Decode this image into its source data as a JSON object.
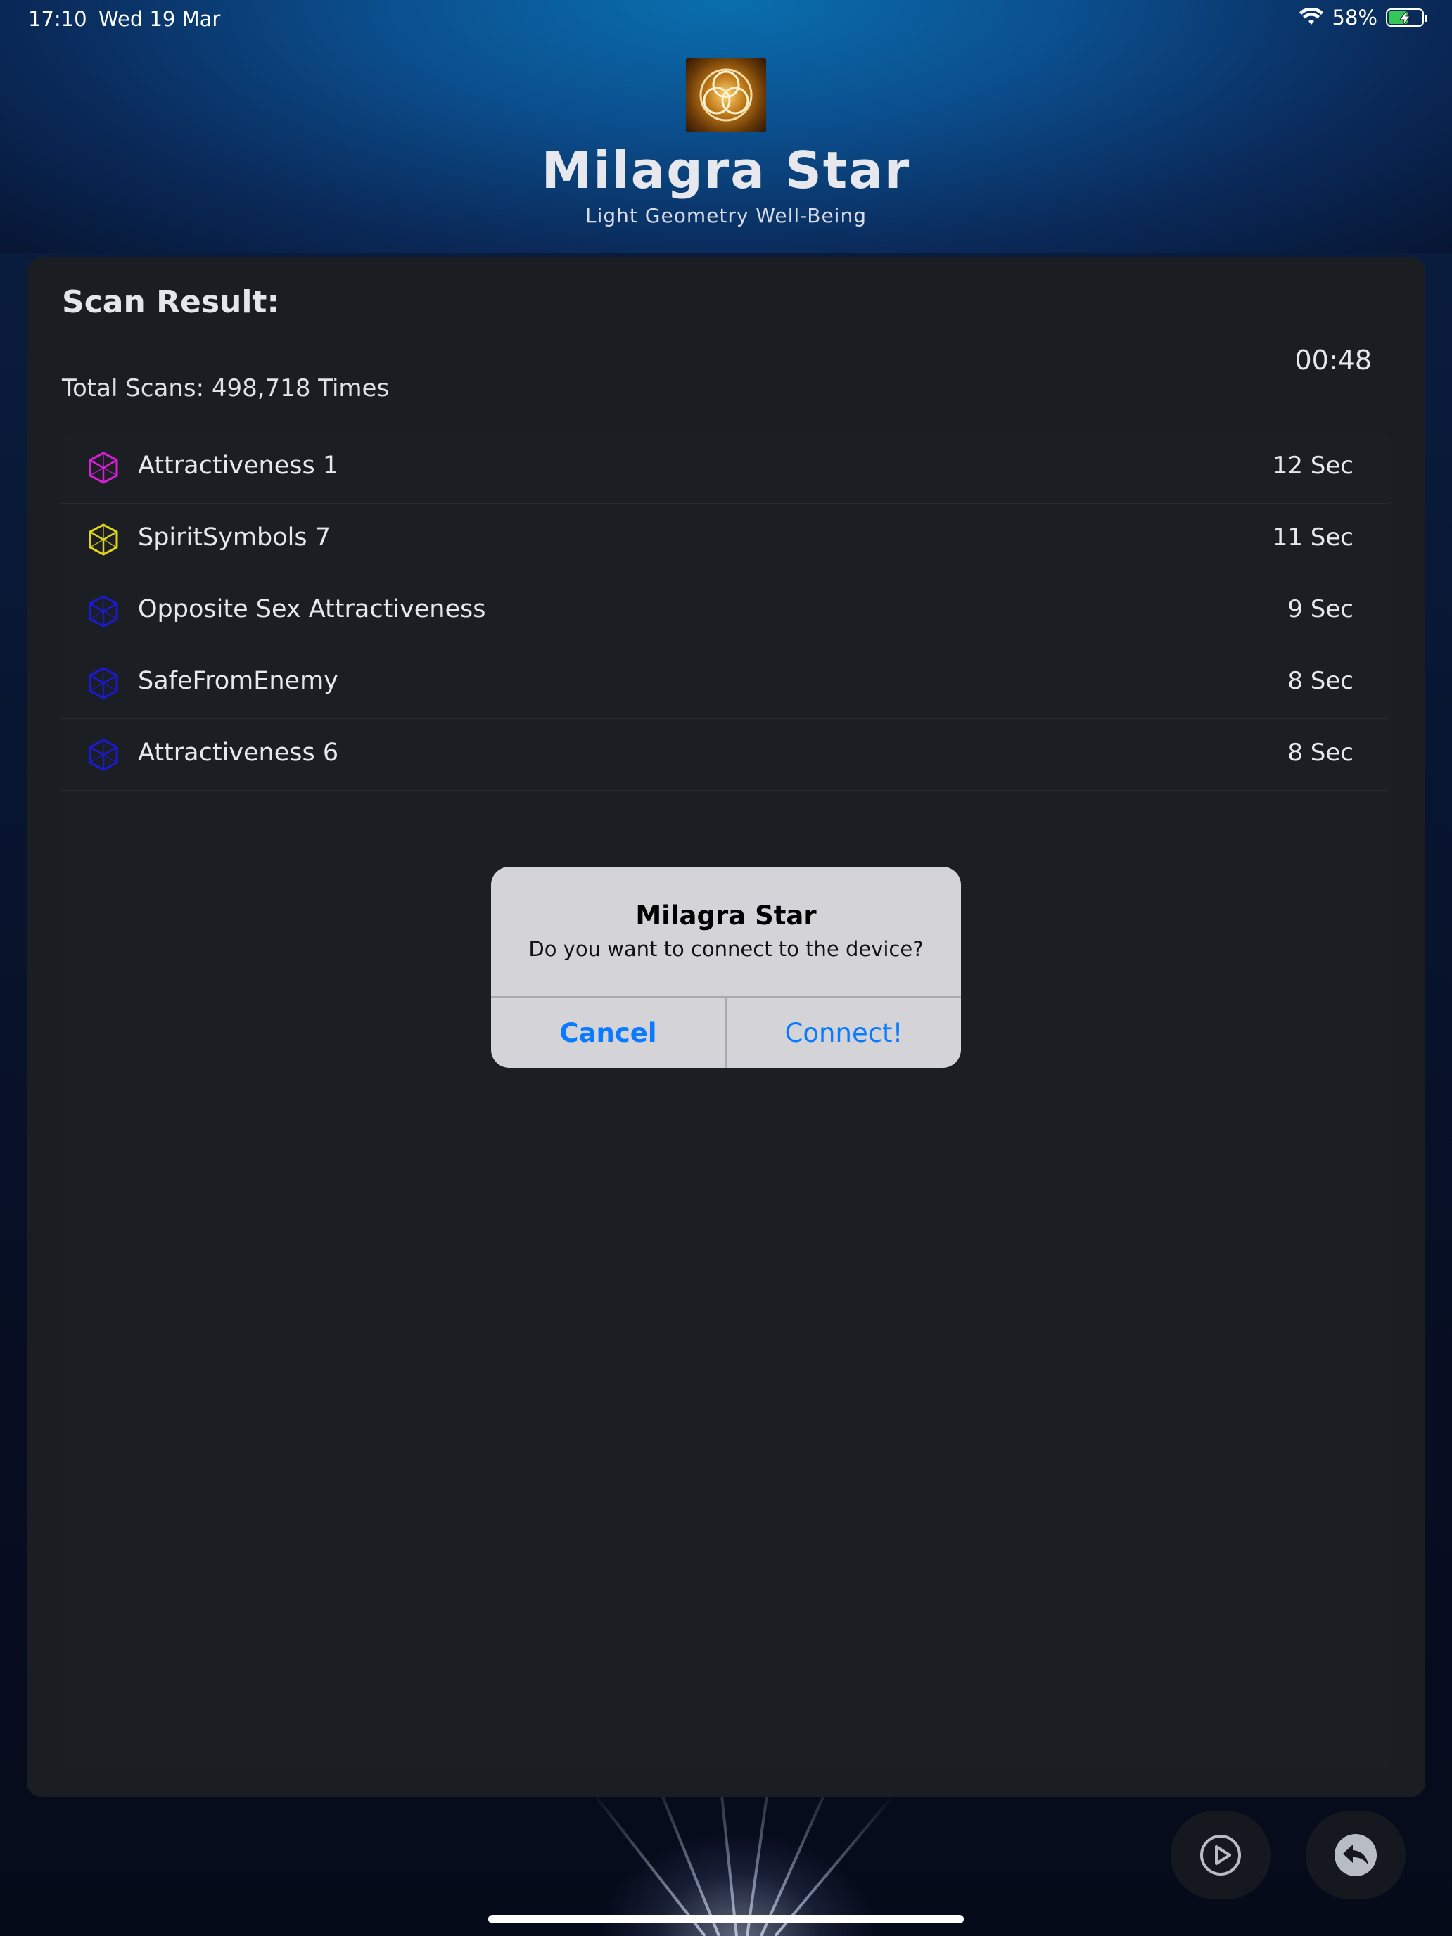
{
  "status_bar": {
    "time": "17:10",
    "date": "Wed 19 Mar",
    "battery_percent": "58%",
    "battery_level": 0.58,
    "wifi_icon": "wifi-icon",
    "battery_icon": "battery-charging-icon"
  },
  "header": {
    "title": "Milagra Star",
    "subtitle": "Light Geometry Well-Being",
    "logo_icon": "triquetra-logo-icon"
  },
  "scan": {
    "heading": "Scan Result:",
    "timer": "00:48",
    "total_scans": "Total Scans: 498,718 Times",
    "items": [
      {
        "label": "Attractiveness 1",
        "value": "12 Sec",
        "icon_color": "#d61fd6"
      },
      {
        "label": "SpiritSymbols 7",
        "value": "11 Sec",
        "icon_color": "#e0d31c"
      },
      {
        "label": "Opposite Sex Attractiveness",
        "value": "9 Sec",
        "icon_color": "#1a1ad6"
      },
      {
        "label": "SafeFromEnemy",
        "value": "8 Sec",
        "icon_color": "#1a1ad6"
      },
      {
        "label": "Attractiveness 6",
        "value": "8 Sec",
        "icon_color": "#1a1ad6"
      }
    ]
  },
  "alert": {
    "title": "Milagra Star",
    "message": "Do you want to connect to the device?",
    "cancel_label": "Cancel",
    "connect_label": "Connect!"
  },
  "controls": {
    "play_icon": "play-icon",
    "back_icon": "back-arrow-icon"
  },
  "colors": {
    "accent": "#0a7aff",
    "card": "#1a1d22"
  }
}
